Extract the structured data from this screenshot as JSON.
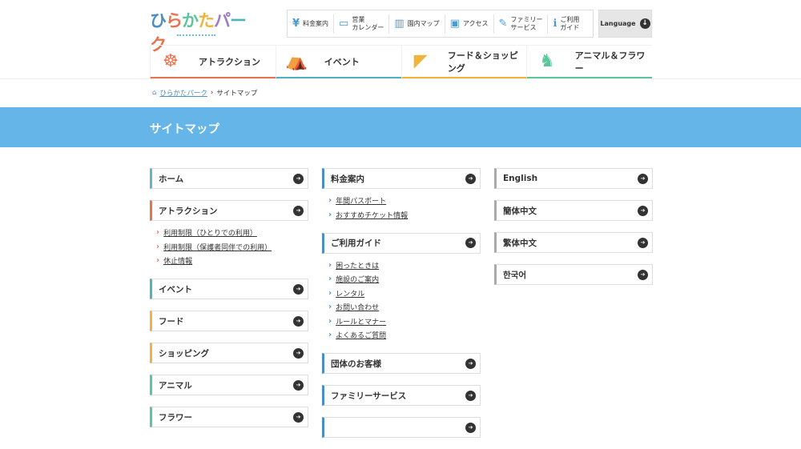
{
  "logo": {
    "text": "ひらかたパーク"
  },
  "utility_nav": [
    {
      "icon": "yen-icon",
      "glyph": "¥",
      "label": "料金案内"
    },
    {
      "icon": "calendar-icon",
      "glyph": "▭",
      "label": "営業\nカレンダー"
    },
    {
      "icon": "map-icon",
      "glyph": "▥",
      "label": "園内マップ"
    },
    {
      "icon": "train-icon",
      "glyph": "▣",
      "label": "アクセス"
    },
    {
      "icon": "bottle-icon",
      "glyph": "✎",
      "label": "ファミリー\nサービス"
    },
    {
      "icon": "info-icon",
      "glyph": "ℹ",
      "label": "ご利用\nガイド"
    }
  ],
  "language": {
    "label": "Language"
  },
  "global_nav": [
    {
      "label": "アトラクション",
      "icon": "ferris-wheel-icon",
      "glyph": "☸",
      "color": "#e8734f"
    },
    {
      "label": "イベント",
      "icon": "tent-icon",
      "glyph": "⛺",
      "color": "#4fb3bf"
    },
    {
      "label": "フード＆ショッピング",
      "icon": "ice-cream-icon",
      "glyph": "◤",
      "color": "#f0b43c"
    },
    {
      "label": "アニマル＆フラワー",
      "icon": "alpaca-icon",
      "glyph": "♞",
      "color": "#5cc59a"
    }
  ],
  "breadcrumb": {
    "home": "ひらかたパーク",
    "current": "サイトマップ"
  },
  "page_title": "サイトマップ",
  "columns": [
    [
      {
        "label": "ホーム",
        "color": "#6ab0d6",
        "links": []
      },
      {
        "label": "アトラクション",
        "color": "#e8734f",
        "links": [
          "利用制限（ひとりでの利用）",
          "利用制限（保護者同伴での利用）",
          "休止情報"
        ],
        "link_color": "#e8734f"
      },
      {
        "label": "イベント",
        "color": "#4fb3bf",
        "links": []
      },
      {
        "label": "フード",
        "color": "#f0b43c",
        "links": []
      },
      {
        "label": "ショッピング",
        "color": "#f0b43c",
        "links": []
      },
      {
        "label": "アニマル",
        "color": "#5cc59a",
        "links": []
      },
      {
        "label": "フラワー",
        "color": "#5cc59a",
        "links": []
      }
    ],
    [
      {
        "label": "料金案内",
        "color": "#4a8fc4",
        "links": [
          "年間パスポート",
          "おすすめチケット情報"
        ],
        "link_color": "#4a8fc4"
      },
      {
        "label": "ご利用ガイド",
        "color": "#4a8fc4",
        "links": [
          "困ったときは",
          "施設のご案内",
          "レンタル",
          "お問い合わせ",
          "ルールとマナー",
          "よくあるご質問"
        ],
        "link_color": "#4a8fc4"
      },
      {
        "label": "団体のお客様",
        "color": "#4a8fc4",
        "links": []
      },
      {
        "label": "ファミリーサービス",
        "color": "#4a8fc4",
        "links": []
      },
      {
        "label": "",
        "color": "#4a8fc4",
        "links": []
      }
    ],
    [
      {
        "label": "English",
        "color": "#aaaaaa",
        "links": []
      },
      {
        "label": "簡体中文",
        "color": "#aaaaaa",
        "links": []
      },
      {
        "label": "繁体中文",
        "color": "#aaaaaa",
        "links": []
      },
      {
        "label": "한국어",
        "color": "#aaaaaa",
        "links": []
      }
    ]
  ]
}
